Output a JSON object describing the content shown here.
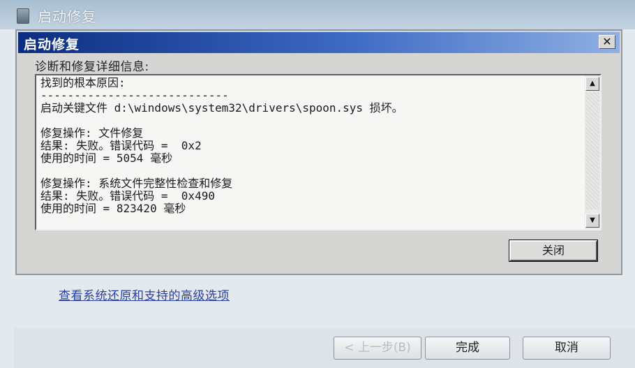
{
  "window": {
    "title": "启动修复"
  },
  "dialog": {
    "title": "启动修复",
    "close_glyph": "✕",
    "details_label": "诊断和修复详细信息:",
    "details_lines": [
      "找到的根本原因:",
      "----------------------------",
      "启动关键文件 d:\\windows\\system32\\drivers\\spoon.sys 损坏。",
      "",
      "修复操作: 文件修复",
      "结果: 失败。错误代码 =  0x2",
      "使用的时间 = 5054 毫秒",
      "",
      "修复操作: 系统文件完整性检查和修复",
      "结果: 失败。错误代码 =  0x490",
      "使用的时间 = 823420 毫秒"
    ],
    "scroll_up_glyph": "▲",
    "scroll_down_glyph": "▼",
    "close_button_label": "关闭"
  },
  "link": {
    "advanced_options": "查看系统还原和支持的高级选项"
  },
  "footer": {
    "back_label": "< 上一步(B)",
    "finish_label": "完成",
    "cancel_label": "取消"
  },
  "icons": {
    "app_icon": "repair-icon",
    "close": "close-icon",
    "scroll_up": "scroll-up-arrow-icon",
    "scroll_down": "scroll-down-arrow-icon"
  },
  "colors": {
    "dialog_title_gradient_start": "#0b2d80",
    "dialog_title_gradient_end": "#8fb0e3",
    "link": "#2a3f9e"
  }
}
